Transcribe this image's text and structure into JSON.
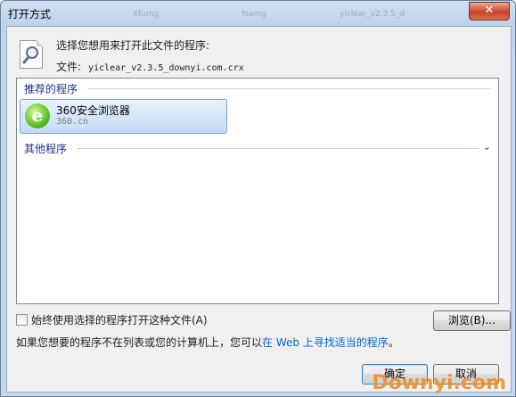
{
  "window": {
    "title": "打开方式",
    "close_glyph": "✕"
  },
  "background_tabs": [
    "Xfumg",
    "fsamg",
    "yiclear_v2.3.5_d"
  ],
  "dialog": {
    "prompt": "选择您想用来打开此文件的程序:",
    "file_label": "文件:",
    "file_name": "yiclear_v2.3.5_downyi.com.crx"
  },
  "groups": {
    "recommended": "推荐的程序",
    "other": "其他程序",
    "other_chevron": "⌄"
  },
  "programs": [
    {
      "name": "360安全浏览器",
      "publisher": "360.cn",
      "icon": "360-browser-icon",
      "selected": true
    }
  ],
  "always_use": {
    "label": "始终使用选择的程序打开这种文件(A)",
    "checked": false
  },
  "browse_button": "浏览(B)...",
  "info": {
    "text": "如果您想要的程序不在列表或您的计算机上，您可以",
    "link": "在 Web 上寻找适当的程序",
    "suffix": "。"
  },
  "buttons": {
    "ok": "确定",
    "cancel": "取消"
  },
  "watermark": "Downyi.com",
  "colors": {
    "accent": "#1e3287",
    "link": "#0066cc",
    "watermark": "#f28c1e",
    "close": "#c9452b"
  }
}
